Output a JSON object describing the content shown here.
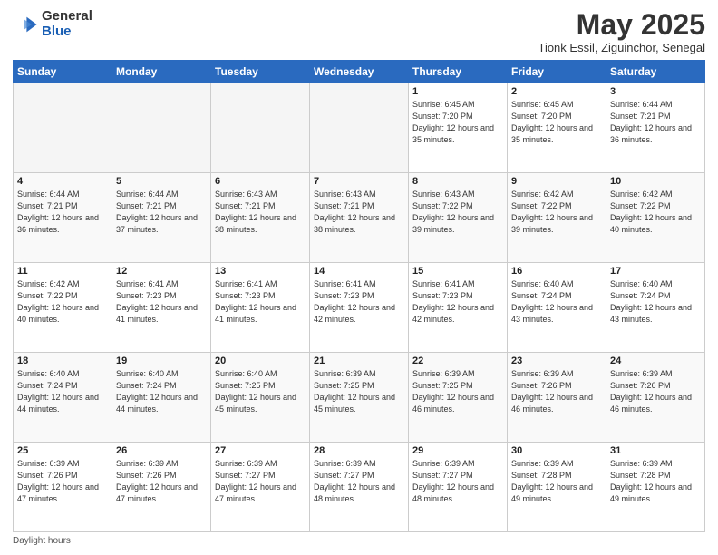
{
  "logo": {
    "general": "General",
    "blue": "Blue"
  },
  "title": "May 2025",
  "subtitle": "Tionk Essil, Ziguinchor, Senegal",
  "footer": "Daylight hours",
  "weekdays": [
    "Sunday",
    "Monday",
    "Tuesday",
    "Wednesday",
    "Thursday",
    "Friday",
    "Saturday"
  ],
  "weeks": [
    [
      {
        "day": "",
        "info": ""
      },
      {
        "day": "",
        "info": ""
      },
      {
        "day": "",
        "info": ""
      },
      {
        "day": "",
        "info": ""
      },
      {
        "day": "1",
        "info": "Sunrise: 6:45 AM\nSunset: 7:20 PM\nDaylight: 12 hours\nand 35 minutes."
      },
      {
        "day": "2",
        "info": "Sunrise: 6:45 AM\nSunset: 7:20 PM\nDaylight: 12 hours\nand 35 minutes."
      },
      {
        "day": "3",
        "info": "Sunrise: 6:44 AM\nSunset: 7:21 PM\nDaylight: 12 hours\nand 36 minutes."
      }
    ],
    [
      {
        "day": "4",
        "info": "Sunrise: 6:44 AM\nSunset: 7:21 PM\nDaylight: 12 hours\nand 36 minutes."
      },
      {
        "day": "5",
        "info": "Sunrise: 6:44 AM\nSunset: 7:21 PM\nDaylight: 12 hours\nand 37 minutes."
      },
      {
        "day": "6",
        "info": "Sunrise: 6:43 AM\nSunset: 7:21 PM\nDaylight: 12 hours\nand 38 minutes."
      },
      {
        "day": "7",
        "info": "Sunrise: 6:43 AM\nSunset: 7:21 PM\nDaylight: 12 hours\nand 38 minutes."
      },
      {
        "day": "8",
        "info": "Sunrise: 6:43 AM\nSunset: 7:22 PM\nDaylight: 12 hours\nand 39 minutes."
      },
      {
        "day": "9",
        "info": "Sunrise: 6:42 AM\nSunset: 7:22 PM\nDaylight: 12 hours\nand 39 minutes."
      },
      {
        "day": "10",
        "info": "Sunrise: 6:42 AM\nSunset: 7:22 PM\nDaylight: 12 hours\nand 40 minutes."
      }
    ],
    [
      {
        "day": "11",
        "info": "Sunrise: 6:42 AM\nSunset: 7:22 PM\nDaylight: 12 hours\nand 40 minutes."
      },
      {
        "day": "12",
        "info": "Sunrise: 6:41 AM\nSunset: 7:23 PM\nDaylight: 12 hours\nand 41 minutes."
      },
      {
        "day": "13",
        "info": "Sunrise: 6:41 AM\nSunset: 7:23 PM\nDaylight: 12 hours\nand 41 minutes."
      },
      {
        "day": "14",
        "info": "Sunrise: 6:41 AM\nSunset: 7:23 PM\nDaylight: 12 hours\nand 42 minutes."
      },
      {
        "day": "15",
        "info": "Sunrise: 6:41 AM\nSunset: 7:23 PM\nDaylight: 12 hours\nand 42 minutes."
      },
      {
        "day": "16",
        "info": "Sunrise: 6:40 AM\nSunset: 7:24 PM\nDaylight: 12 hours\nand 43 minutes."
      },
      {
        "day": "17",
        "info": "Sunrise: 6:40 AM\nSunset: 7:24 PM\nDaylight: 12 hours\nand 43 minutes."
      }
    ],
    [
      {
        "day": "18",
        "info": "Sunrise: 6:40 AM\nSunset: 7:24 PM\nDaylight: 12 hours\nand 44 minutes."
      },
      {
        "day": "19",
        "info": "Sunrise: 6:40 AM\nSunset: 7:24 PM\nDaylight: 12 hours\nand 44 minutes."
      },
      {
        "day": "20",
        "info": "Sunrise: 6:40 AM\nSunset: 7:25 PM\nDaylight: 12 hours\nand 45 minutes."
      },
      {
        "day": "21",
        "info": "Sunrise: 6:39 AM\nSunset: 7:25 PM\nDaylight: 12 hours\nand 45 minutes."
      },
      {
        "day": "22",
        "info": "Sunrise: 6:39 AM\nSunset: 7:25 PM\nDaylight: 12 hours\nand 46 minutes."
      },
      {
        "day": "23",
        "info": "Sunrise: 6:39 AM\nSunset: 7:26 PM\nDaylight: 12 hours\nand 46 minutes."
      },
      {
        "day": "24",
        "info": "Sunrise: 6:39 AM\nSunset: 7:26 PM\nDaylight: 12 hours\nand 46 minutes."
      }
    ],
    [
      {
        "day": "25",
        "info": "Sunrise: 6:39 AM\nSunset: 7:26 PM\nDaylight: 12 hours\nand 47 minutes."
      },
      {
        "day": "26",
        "info": "Sunrise: 6:39 AM\nSunset: 7:26 PM\nDaylight: 12 hours\nand 47 minutes."
      },
      {
        "day": "27",
        "info": "Sunrise: 6:39 AM\nSunset: 7:27 PM\nDaylight: 12 hours\nand 47 minutes."
      },
      {
        "day": "28",
        "info": "Sunrise: 6:39 AM\nSunset: 7:27 PM\nDaylight: 12 hours\nand 48 minutes."
      },
      {
        "day": "29",
        "info": "Sunrise: 6:39 AM\nSunset: 7:27 PM\nDaylight: 12 hours\nand 48 minutes."
      },
      {
        "day": "30",
        "info": "Sunrise: 6:39 AM\nSunset: 7:28 PM\nDaylight: 12 hours\nand 49 minutes."
      },
      {
        "day": "31",
        "info": "Sunrise: 6:39 AM\nSunset: 7:28 PM\nDaylight: 12 hours\nand 49 minutes."
      }
    ]
  ]
}
